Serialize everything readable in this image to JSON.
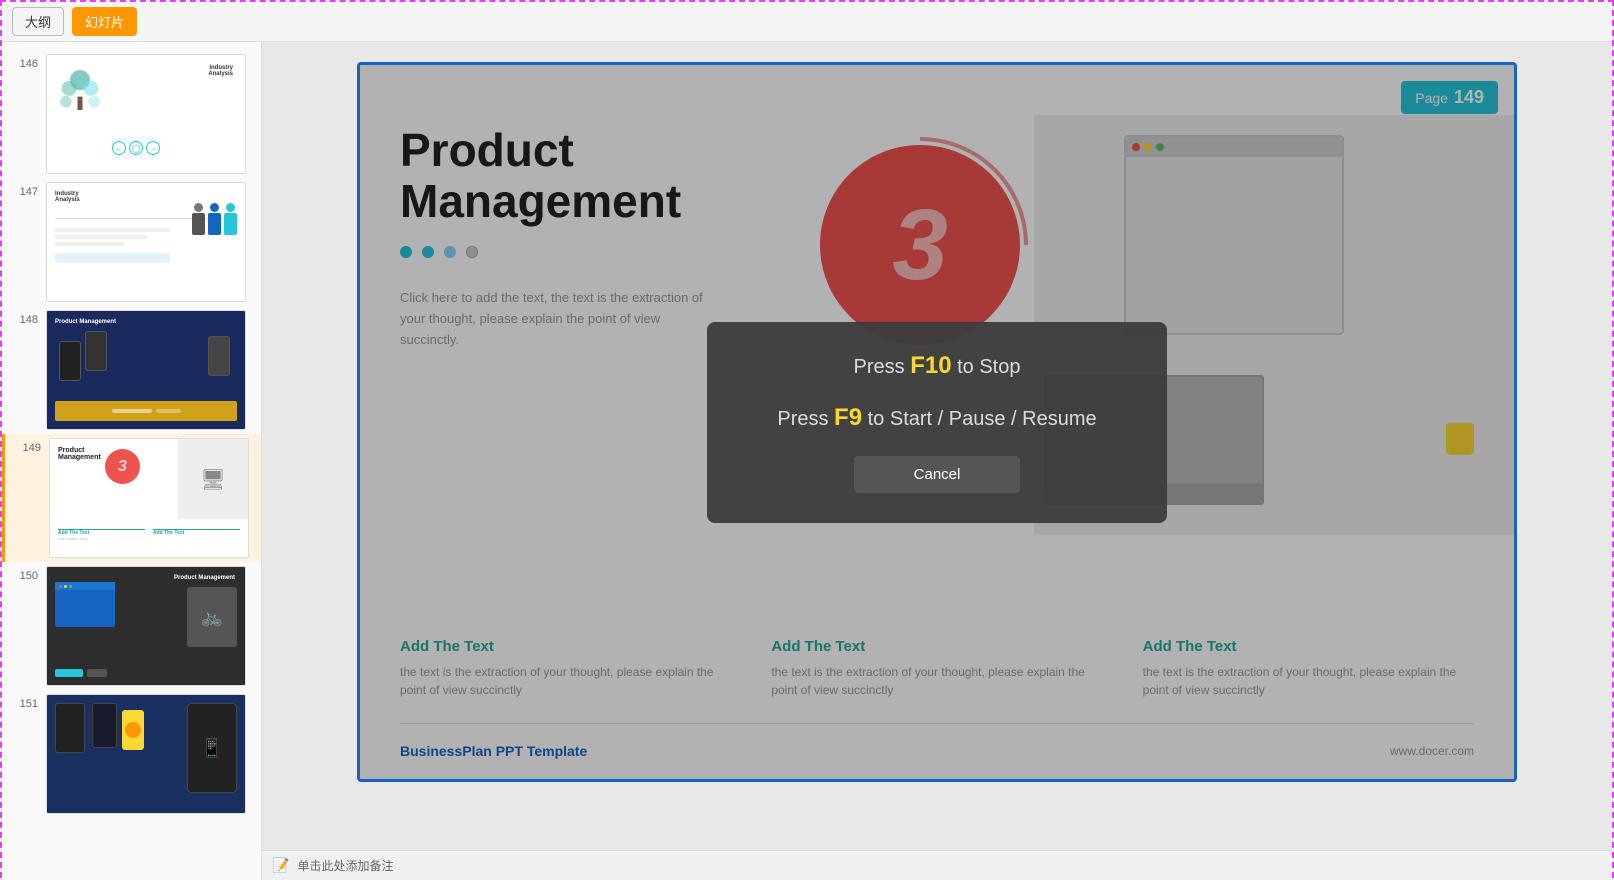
{
  "topBar": {
    "outline_label": "大纲",
    "slides_label": "幻灯片"
  },
  "sidebar": {
    "slides": [
      {
        "num": "146",
        "id": "s146"
      },
      {
        "num": "147",
        "id": "s147"
      },
      {
        "num": "148",
        "id": "s148"
      },
      {
        "num": "149",
        "id": "s149",
        "active": true
      },
      {
        "num": "150",
        "id": "s150"
      },
      {
        "num": "151",
        "id": "s151"
      }
    ]
  },
  "mainSlide": {
    "pageBadge": {
      "label": "Page",
      "number": "149"
    },
    "circle": {
      "number": "3"
    },
    "title": {
      "line1": "Product",
      "line2": "Management"
    },
    "description": "Click here to add the text, the text is the extraction of your thought, please explain the point of view succinctly.",
    "columns": [
      {
        "heading": "Add The Text",
        "text": "the text is the extraction of your thought, please explain the point of view succinctly"
      },
      {
        "heading": "Add The Text",
        "text": "the text is the extraction of your thought, please explain the point of view succinctly"
      },
      {
        "heading": "Add The Text",
        "text": "the text is the extraction of your thought, please explain the point of view succinctly"
      }
    ],
    "footer": {
      "brand": "BusinessPlan PPT Template",
      "url": "www.docer.com"
    }
  },
  "modal": {
    "line1_prefix": "Press ",
    "line1_key": "F10",
    "line1_suffix": " to Stop",
    "line2_prefix": "Press ",
    "line2_key": "F9",
    "line2_suffix": " to Start / Pause / Resume",
    "cancel_label": "Cancel"
  },
  "statusBar": {
    "icon": "📝",
    "text": "单击此处添加备注"
  },
  "colors": {
    "accent_blue": "#1565c0",
    "accent_cyan": "#26c6da",
    "accent_red": "#ef5350",
    "accent_teal": "#26a69a",
    "accent_orange": "#ff9800",
    "modal_bg": "rgba(60,60,60,0.95)"
  }
}
